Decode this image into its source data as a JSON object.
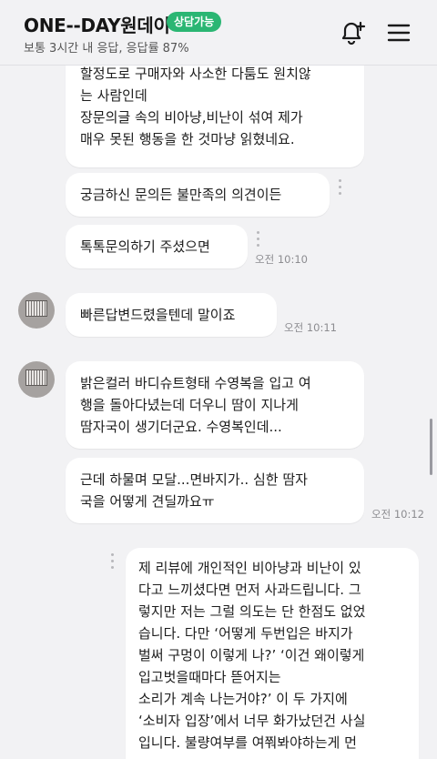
{
  "header": {
    "title": "ONE--DAY원데이",
    "badge": "상담가능",
    "subtitle": "보통 3시간 내 응답, 응답률 87%",
    "icons": [
      "bell-plus-icon",
      "menu-icon"
    ]
  },
  "messages": {
    "m1": "할정도로 구매자와 사소한 다툼도 원치않\n는 사람인데\n장문의글 속의 비아냥,비난이 섞여 제가\n매우 못된 행동을 한 것마냥 읽혔네요.",
    "m2": "궁금하신 문의든 불만족의 의견이든",
    "m3": "톡톡문의하기 주셨으면",
    "t1": "오전 10:10",
    "m4": "빠른답변드렸을텐데 말이죠",
    "t2": "오전 10:11",
    "m5": "밝은컬러 바디슈트형태 수영복을 입고 여\n행을 돌아다녔는데 더우니 땀이 지나게\n땀자국이 생기더군요. 수영복인데...",
    "m6": "근데 하물며 모달...면바지가.. 심한 땀자\n국을 어떻게 견딜까요ㅠ",
    "t3": "오전 10:12",
    "m7": "제 리뷰에 개인적인 비아냥과 비난이 있\n다고 느끼셨다면 먼저 사과드립니다. 그\n렇지만 저는 그럴 의도는 단 한점도 없었\n습니다. 다만 ‘어떻게 두번입은 바지가\n벌써 구멍이 이렇게 나?’ ‘이건 왜이렇게\n입고벗을때마다 뜯어지는\n소리가 계속 나는거야?’ 이 두 가지에\n‘소비자 입장’에서 너무 화가났던건 사실\n입니다. 불량여부를 여쭤봐야하는게 먼"
  },
  "colors": {
    "badge": "#2bb673",
    "bubble": "#ffffff",
    "background": "#f2f2f4"
  }
}
